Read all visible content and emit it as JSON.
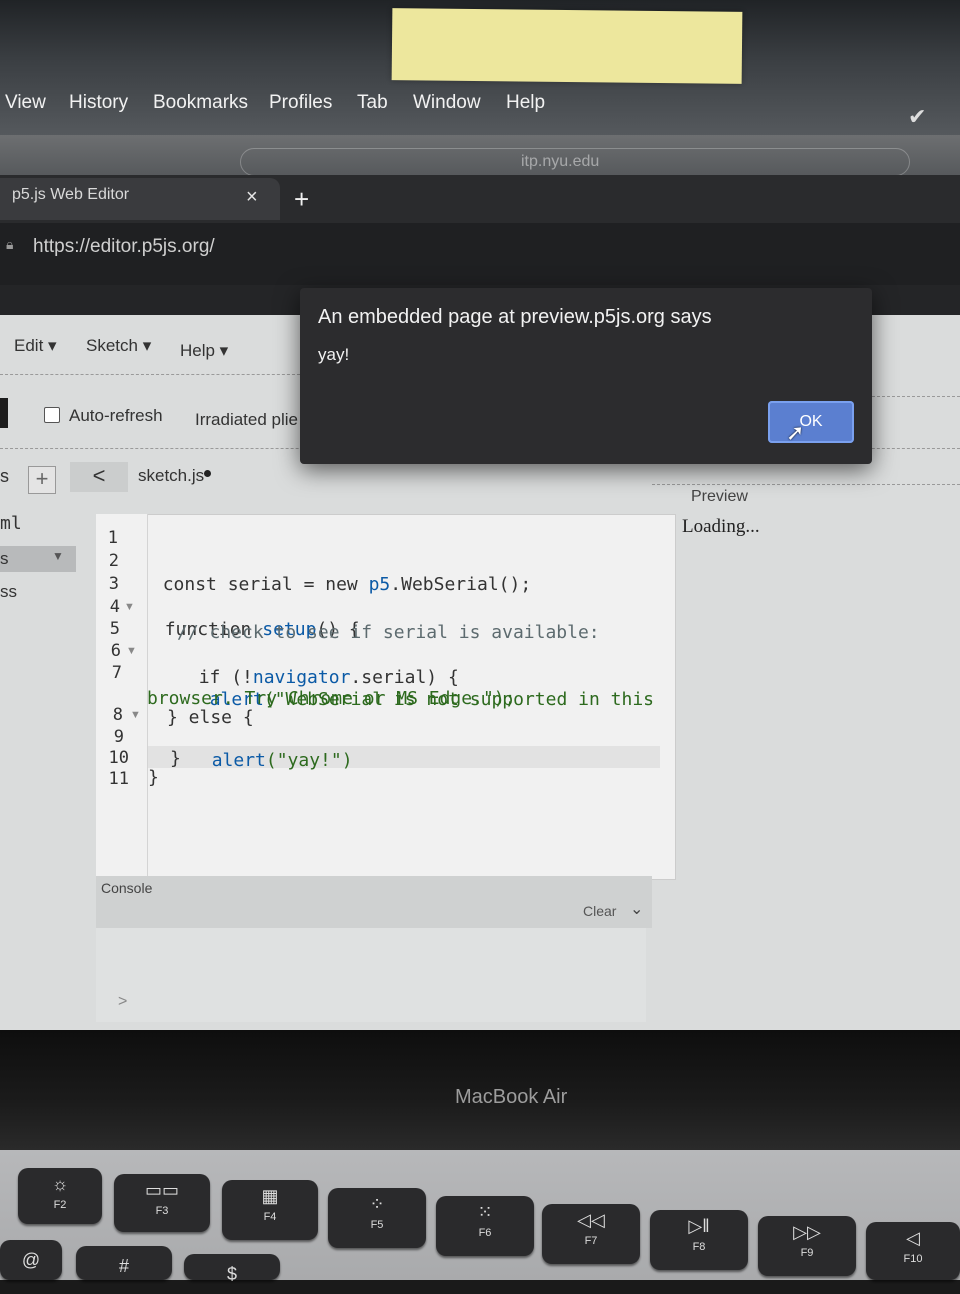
{
  "mac_menu": {
    "items": [
      "View",
      "History",
      "Bookmarks",
      "Profiles",
      "Tab",
      "Window",
      "Help"
    ]
  },
  "address_ghost": "itp.nyu.edu",
  "browser": {
    "tab_title": "p5.js Web Editor",
    "tab_close": "×",
    "new_tab": "+",
    "url": "https://editor.p5js.org/"
  },
  "p5_menu": {
    "edit": "Edit ▾",
    "sketch": "Sketch ▾",
    "help": "Help ▾"
  },
  "toolbar": {
    "autorefresh_label": "Auto-refresh",
    "sketch_name": "Irradiated plie"
  },
  "sidebar": {
    "add": "+",
    "collapse": "<",
    "partial_s": "s",
    "file_ml": "ml",
    "file_s": "s",
    "file_ss": "ss"
  },
  "editor": {
    "tab_label": "sketch.js",
    "line_numbers": [
      "1",
      "2",
      "3",
      "4",
      "5",
      "6",
      "7",
      "8",
      "9",
      "10",
      "11"
    ],
    "code": {
      "l2a": "const serial = new ",
      "l2b": "p5",
      "l2c": ".WebSerial();",
      "l4a": "function ",
      "l4b": "setup",
      "l4c": "() {",
      "l5": "// check to see if serial is available:",
      "l6a": "if (!",
      "l6b": "navigator",
      "l6c": ".serial) {",
      "l7a": "alert",
      "l7b": "(\"WebSerial is not supported in this",
      "l7c": "browser. Try Chrome or MS Edge.\");",
      "l8": "} else {",
      "l9a": "alert",
      "l9b": "(\"yay!\")",
      "l10": "}",
      "l11": "}"
    }
  },
  "console": {
    "label": "Console",
    "clear": "Clear",
    "prompt": ">"
  },
  "preview": {
    "label": "Preview",
    "loading": "Loading..."
  },
  "dialog": {
    "title": "An embedded page at preview.p5js.org says",
    "message": "yay!",
    "ok": "OK"
  },
  "laptop": {
    "model": "MacBook Air"
  },
  "keyboard": {
    "keys": [
      {
        "glyph": "☼",
        "label": "F2"
      },
      {
        "glyph": "▭▭",
        "label": "F3"
      },
      {
        "glyph": "▦",
        "label": "F4"
      },
      {
        "glyph": "⁘",
        "label": "F5"
      },
      {
        "glyph": "⁙",
        "label": "F6"
      },
      {
        "glyph": "◁◁",
        "label": "F7"
      },
      {
        "glyph": "▷‖",
        "label": "F8"
      },
      {
        "glyph": "▷▷",
        "label": "F9"
      },
      {
        "glyph": "◁",
        "label": "F10"
      }
    ],
    "row2": [
      "@",
      "#",
      "$"
    ]
  }
}
